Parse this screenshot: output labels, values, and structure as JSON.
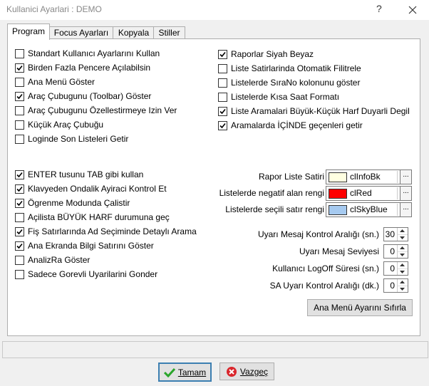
{
  "window": {
    "title": "Kullanici Ayarlari : DEMO",
    "help_glyph": "?"
  },
  "tabs": [
    {
      "label": "Program",
      "active": true
    },
    {
      "label": "Focus Ayarları",
      "active": false
    },
    {
      "label": "Kopyala",
      "active": false
    },
    {
      "label": "Stiller",
      "active": false
    }
  ],
  "left_options_1": [
    {
      "label": "Standart Kullanıcı Ayarlarını Kullan",
      "checked": false
    },
    {
      "label": "Birden Fazla Pencere Açılabilsin",
      "checked": true
    },
    {
      "label": "Ana Menü Göster",
      "checked": false
    },
    {
      "label": "Araç Çubugunu (Toolbar) Göster",
      "checked": true
    },
    {
      "label": "Araç Çubugunu Özellestirmeye Izin Ver",
      "checked": false
    },
    {
      "label": "Küçük Araç Çubuğu",
      "checked": false
    },
    {
      "label": "Loginde Son Listeleri Getir",
      "checked": false
    }
  ],
  "right_options": [
    {
      "label": "Raporlar Siyah Beyaz",
      "checked": true
    },
    {
      "label": "Liste Satirlarinda Otomatik Filitrele",
      "checked": false
    },
    {
      "label": "Listelerde SıraNo kolonunu göster",
      "checked": false
    },
    {
      "label": "Listelerde Kısa Saat Formatı",
      "checked": false
    },
    {
      "label": "Liste Aramalari Büyük-Küçük Harf Duyarli Degil",
      "checked": true
    },
    {
      "label": "Aramalarda İÇİNDE geçenleri getir",
      "checked": true
    }
  ],
  "left_options_2": [
    {
      "label": "ENTER tusunu TAB gibi kullan",
      "checked": true
    },
    {
      "label": "Klavyeden Ondalik Ayiraci Kontrol Et",
      "checked": true
    },
    {
      "label": "Ögrenme Modunda Çalistir",
      "checked": true
    },
    {
      "label": "Açilista BÜYÜK HARF durumuna geç",
      "checked": false
    },
    {
      "label": "Fiş Satırlarında Ad Seçiminde Detaylı Arama",
      "checked": true
    },
    {
      "label": "Ana Ekranda Bilgi Satırını Göster",
      "checked": true
    },
    {
      "label": "AnalizRa Göster",
      "checked": false
    },
    {
      "label": "Sadece Gorevli Uyarilarini Gonder",
      "checked": false
    }
  ],
  "colors": [
    {
      "label": "Rapor Liste Satiri",
      "value": "clInfoBk",
      "swatch": "#ffffe1"
    },
    {
      "label": "Listelerde negatif alan rengi",
      "value": "clRed",
      "swatch": "#ff0000"
    },
    {
      "label": "Listelerde seçili satır rengi",
      "value": "clSkyBlue",
      "swatch": "#a6caf0"
    }
  ],
  "ellipsis": "...",
  "numbers": [
    {
      "label": "Uyarı Mesaj Kontrol Aralığı (sn.)",
      "value": "30"
    },
    {
      "label": "Uyarı Mesaj Seviyesi",
      "value": "0"
    },
    {
      "label": "Kullanıcı LogOff Süresi (sn.)",
      "value": "0"
    },
    {
      "label": "SA Uyarı Kontrol Aralığı (dk.)",
      "value": "0"
    }
  ],
  "reset_button": "Ana Menü Ayarını Sıfırla",
  "ok_button": "Tamam",
  "cancel_button": "Vazgeç"
}
